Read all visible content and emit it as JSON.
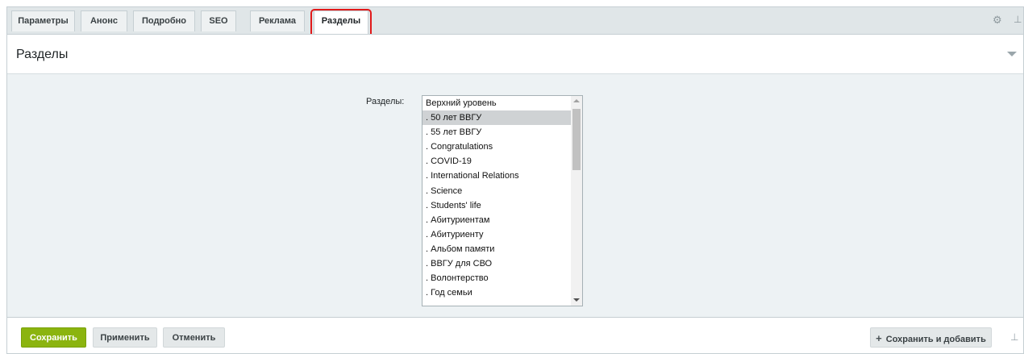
{
  "tabs": [
    {
      "label": "Параметры"
    },
    {
      "label": "Анонс"
    },
    {
      "label": "Подробно"
    },
    {
      "label": "SEO"
    },
    {
      "label": "Реклама"
    },
    {
      "label": "Разделы"
    }
  ],
  "active_tab": "Разделы",
  "panel": {
    "title": "Разделы"
  },
  "field": {
    "label": "Разделы:",
    "options": [
      "Верхний уровень",
      ". 50 лет ВВГУ",
      ". 55 лет ВВГУ",
      ". Congratulations",
      ". COVID-19",
      ". International Relations",
      ". Science",
      ". Students' life",
      ". Абитуриентам",
      ". Абитуриенту",
      ". Альбом памяти",
      ". ВВГУ для СВО",
      ". Волонтерство",
      ". Год семьи"
    ],
    "selected": ". 50 лет ВВГУ"
  },
  "footer": {
    "save": "Сохранить",
    "apply": "Применить",
    "cancel": "Отменить",
    "save_add": "Сохранить и добавить"
  },
  "colors": {
    "accent": "#8bb40f",
    "highlight": "#e11a1a"
  }
}
